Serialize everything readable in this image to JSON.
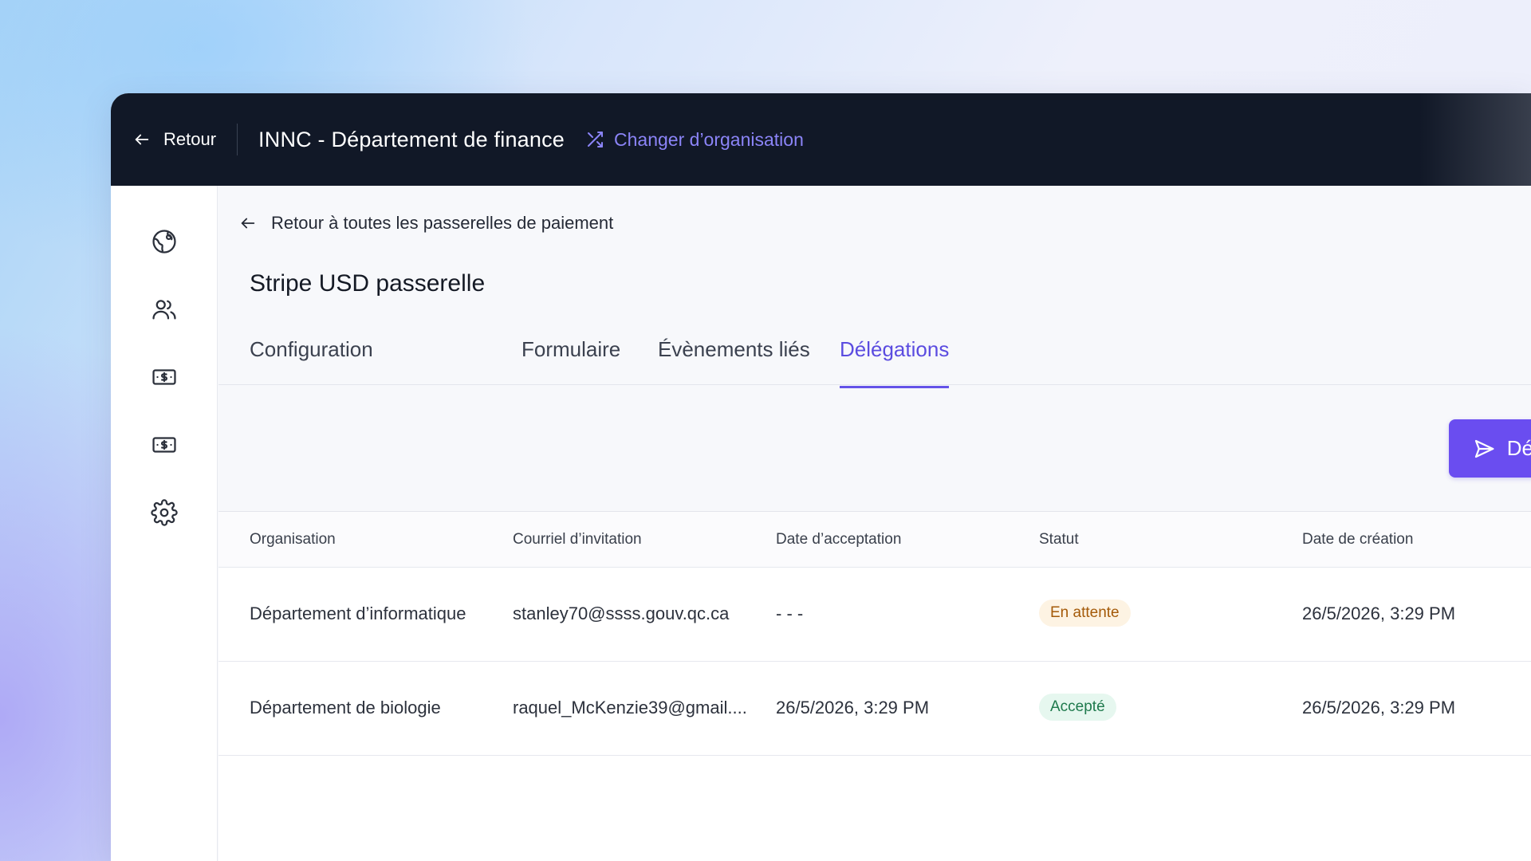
{
  "topbar": {
    "back_label": "Retour",
    "org_title": "INNC - Département de finance",
    "switch_label": "Changer d’organisation"
  },
  "sidebar": {
    "items": [
      {
        "icon": "globe-icon"
      },
      {
        "icon": "users-icon"
      },
      {
        "icon": "cash-icon"
      },
      {
        "icon": "cash-icon"
      },
      {
        "icon": "gear-icon"
      }
    ]
  },
  "breadcrumb": {
    "label": "Retour à toutes les passerelles de paiement"
  },
  "page": {
    "title": "Stripe USD passerelle"
  },
  "tabs": [
    {
      "label": "Configuration",
      "active": false
    },
    {
      "label": "Formulaire",
      "active": false
    },
    {
      "label": "Évènements liés",
      "active": false
    },
    {
      "label": "Délégations",
      "active": true
    }
  ],
  "actions": {
    "delegate_label": "Déléguer"
  },
  "table": {
    "columns": [
      "Organisation",
      "Courriel d’invitation",
      "Date d’acceptation",
      "Statut",
      "Date de création"
    ],
    "rows": [
      {
        "organisation": "Département d’informatique",
        "email": "stanley70@ssss.gouv.qc.ca",
        "accepted_at": "- - -",
        "status": "En attente",
        "created_at": "26/5/2026, 3:29 PM"
      },
      {
        "organisation": "Département de biologie",
        "email": "raquel_McKenzie39@gmail....",
        "accepted_at": "26/5/2026, 3:29 PM",
        "status": "Accepté",
        "created_at": "26/5/2026, 3:29 PM"
      }
    ]
  },
  "colors": {
    "accent": "#6a4df0",
    "topbar_bg": "#111827",
    "tab_active": "#5b4ce0",
    "pending_bg": "#fdf3e3",
    "pending_text": "#a45a09",
    "accepted_bg": "#e6f7ef",
    "accepted_text": "#1f7a4d"
  }
}
